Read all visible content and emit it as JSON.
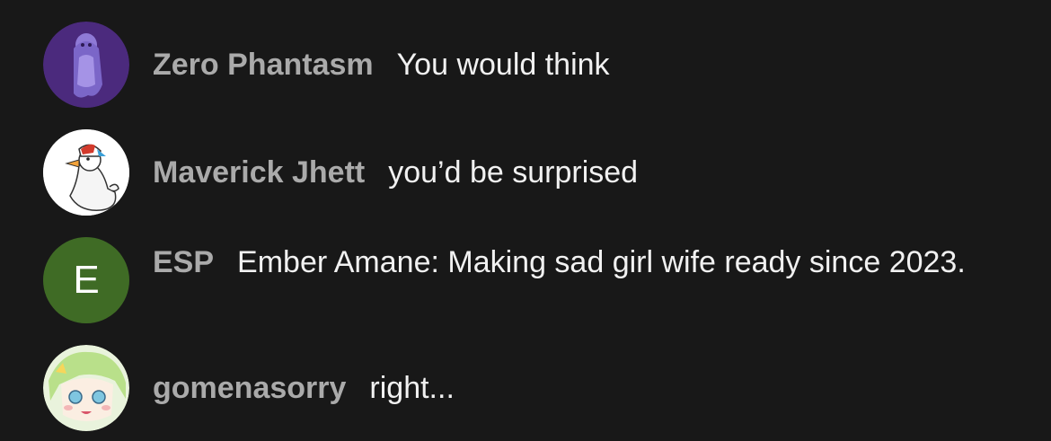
{
  "messages": [
    {
      "author": "Zero Phantasm",
      "text": "You would think",
      "avatar_icon": "ghost-girl-avatar",
      "avatar_color": "#4a2a7a"
    },
    {
      "author": "Maverick Jhett",
      "text": "you’d be surprised",
      "avatar_icon": "duck-with-cap-avatar",
      "avatar_color": "#ffffff"
    },
    {
      "author": "ESP",
      "text": "Ember Amane: Making sad girl wife ready since 2023.",
      "avatar_letter": "E",
      "avatar_color": "#3f6b25"
    },
    {
      "author": "gomenasorry",
      "text": "right...",
      "avatar_icon": "green-hair-anime-avatar",
      "avatar_color": "#dfeecb"
    }
  ]
}
